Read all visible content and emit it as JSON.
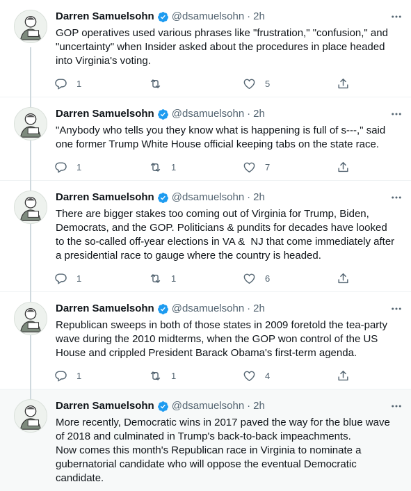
{
  "author": {
    "name": "Darren Samuelsohn",
    "handle": "@dsamuelsohn",
    "separator": "·",
    "verified_icon": "verified-badge-icon",
    "avatar_icon": "person-illustration-avatar"
  },
  "colors": {
    "verified": "#1d9bf0",
    "icon_gray": "#536471",
    "thread_line": "#cfd9de",
    "highlight_bg": "#f7f9f9"
  },
  "tweets": [
    {
      "time": "2h",
      "text": "GOP operatives used various phrases like \"frustration,\" \"confusion,\" and \"uncertainty\" when Insider asked about the procedures in place headed into Virginia's voting.",
      "replies": "1",
      "retweets": "",
      "likes": "5"
    },
    {
      "time": "2h",
      "text": "\"Anybody who tells you they know what is happening is full of s---,\" said one former Trump White House official keeping tabs on the state race.",
      "replies": "1",
      "retweets": "1",
      "likes": "7"
    },
    {
      "time": "2h",
      "text": "There are bigger stakes too coming out of Virginia for Trump, Biden, Democrats, and the GOP. Politicians & pundits for decades have looked to the so-called off-year elections in VA &  NJ that come immediately after a presidential race to gauge where the country is headed.",
      "replies": "1",
      "retweets": "1",
      "likes": "6"
    },
    {
      "time": "2h",
      "text": "Republican sweeps in both of those states in 2009 foretold the tea-party wave during the 2010 midterms, when the GOP won control of the US House and crippled President Barack Obama's first-term agenda.",
      "replies": "1",
      "retweets": "1",
      "likes": "4"
    },
    {
      "time": "2h",
      "text": "More recently, Democratic wins in 2017 paved the way for the blue wave of 2018 and culminated in Trump's back-to-back impeachments.\nNow comes this month's Republican race in Virginia to nominate a gubernatorial candidate who will oppose the eventual Democratic candidate.",
      "replies": "",
      "retweets": "",
      "likes": ""
    }
  ]
}
